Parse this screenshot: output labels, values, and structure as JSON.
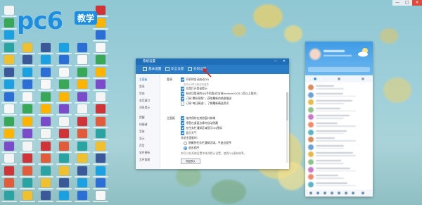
{
  "logo": {
    "brand": "pc6",
    "tag": "教学"
  },
  "window_controls": {
    "minimize": "—",
    "restore": "□",
    "close": "✕"
  },
  "settings_window": {
    "title": "系统设置",
    "title_controls": "— ✕",
    "tabs": [
      {
        "label": "基本设置",
        "icon": "gear-icon"
      },
      {
        "label": "安全设置",
        "icon": "shield-icon"
      },
      {
        "label": "权限设置",
        "icon": "lock-icon"
      }
    ],
    "sidebar": [
      "主面板",
      "登录",
      "状态",
      "会话窗口",
      "消息提示",
      "提醒",
      "快捷键",
      "音效",
      "显示",
      "声音",
      "软件更新",
      "文件管理"
    ],
    "sections": [
      {
        "heading": "登录",
        "rows": [
          {
            "label": "开机时自动启动QQ",
            "checked": true
          },
          {
            "label": "启动QQ时为我自动登录",
            "checked": false,
            "subtle": true
          },
          {
            "label": "总是打开登录提示",
            "checked": true
          },
          {
            "label": "有成功登录的QQ手机版(仅支持Android QQ5.1及以上版本)",
            "checked": true
          },
          {
            "label": "订阅“腾讯视频”，获取最新的热剧推送",
            "checked": true
          },
          {
            "label": "订阅“每日精选”，了解最新精选资讯",
            "checked": false
          }
        ]
      },
      {
        "heading": "主面板",
        "rows": [
          {
            "label": "始终保持在其他窗口前端",
            "checked": true
          },
          {
            "label": "停靠在桌面边缘时自动隐藏",
            "checked": true
          },
          {
            "label": "在任务栏通知区域显示QQ图标",
            "checked": true
          },
          {
            "label": "显示天气",
            "checked": true
          }
        ],
        "close_label": "关闭主面板时：",
        "close_options": [
          {
            "label": "隐藏到任务栏通知区域，不退出程序",
            "selected": false
          },
          {
            "label": "退出程序",
            "selected": true
          }
        ],
        "note": "你可以在系统设置中修改默认设置，使用QQ更有效率。",
        "button": "恢复默认"
      }
    ]
  },
  "qq_panel": {
    "items": 14
  },
  "colors": {
    "accent": "#1e6fb8",
    "tab_bar": "#2a7cc6",
    "checkbox": "#2f86d6",
    "brand": "#1e8fe0",
    "arrow": "#e0201a"
  }
}
